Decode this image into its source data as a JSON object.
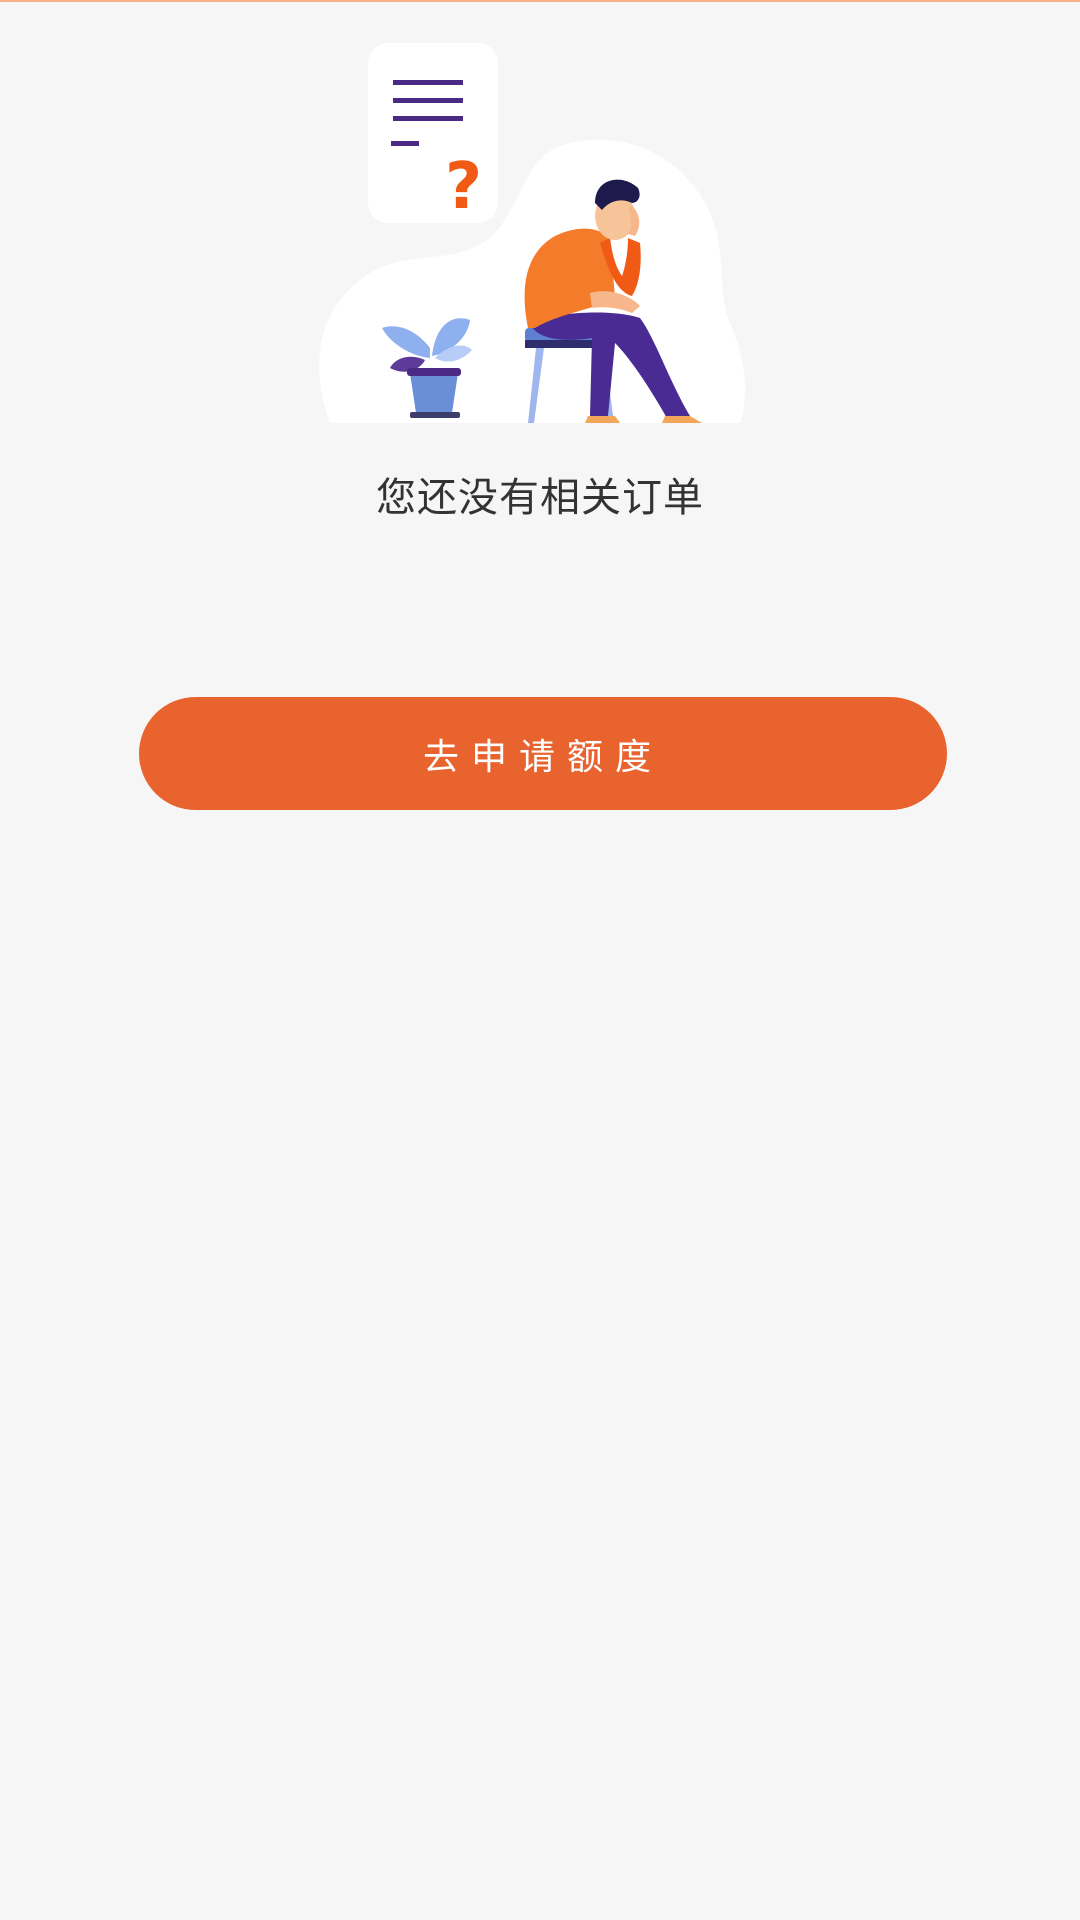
{
  "page": {
    "empty_message": "您还没有相关订单",
    "apply_button_label": "去申请额度"
  },
  "colors": {
    "background": "#f6f6f6",
    "top_accent": "#f5b183",
    "primary_button": "#e8632e",
    "illustration_shirt": "#f47b2a",
    "illustration_pants": "#4a2a93",
    "illustration_plant": "#8fb0ef",
    "illustration_question": "#f05a14",
    "illustration_lines": "#4b2a85"
  },
  "icons": {
    "illustration": "empty-orders-illustration",
    "document": "document-question-icon",
    "plant": "potted-plant-icon"
  }
}
